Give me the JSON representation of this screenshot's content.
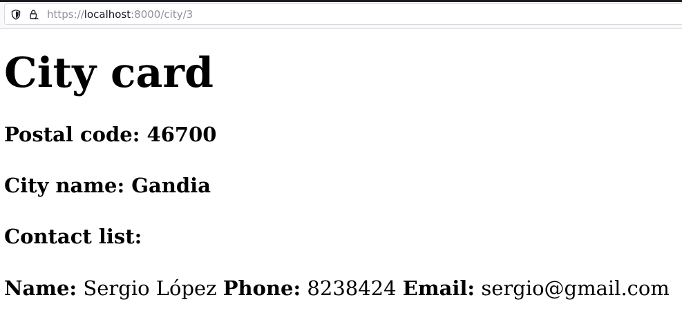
{
  "browser": {
    "url_prefix": "https://",
    "url_host": "localhost",
    "url_rest": ":8000/city/3",
    "icons": [
      "shield-icon",
      "lock-icon"
    ]
  },
  "page": {
    "title": "City card",
    "postal": {
      "label": "Postal code:",
      "value": "46700"
    },
    "city": {
      "label": "City name:",
      "value": "Gandia"
    },
    "contact_list_label": "Contact list:",
    "contacts": [
      {
        "name_label": "Name:",
        "name": "Sergio López",
        "phone_label": "Phone:",
        "phone": "8238424",
        "email_label": "Email:",
        "email": "sergio@gmail.com"
      }
    ]
  },
  "colors": {
    "url_gray": "#8f8f9d",
    "url_host": "#15141a",
    "text": "#000000"
  }
}
